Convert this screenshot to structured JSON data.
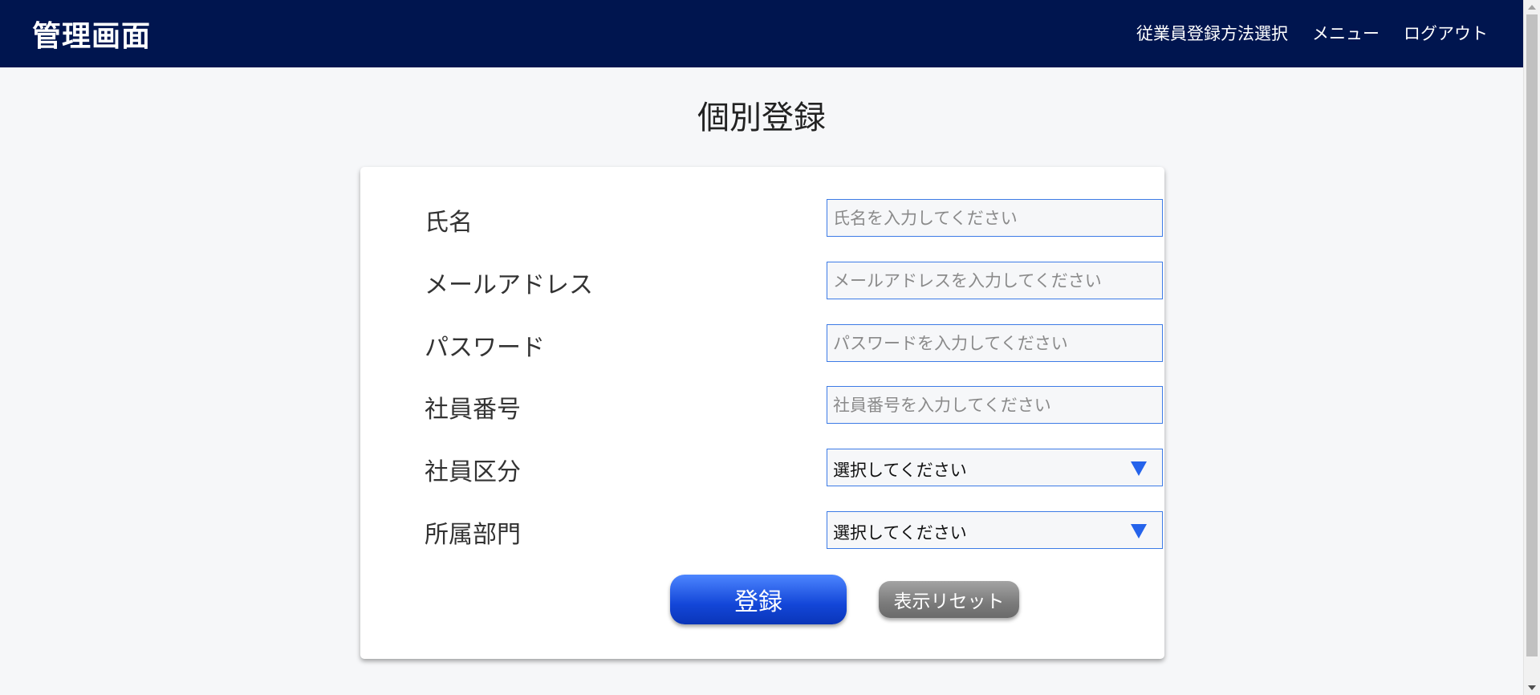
{
  "header": {
    "logo": "管理画面",
    "nav": [
      {
        "label": "従業員登録方法選択"
      },
      {
        "label": "メニュー"
      },
      {
        "label": "ログアウト"
      }
    ],
    "background": "#00154f"
  },
  "page": {
    "title": "個別登録"
  },
  "form": {
    "name": {
      "label": "氏名",
      "placeholder": "氏名を入力してください",
      "value": ""
    },
    "email": {
      "label": "メールアドレス",
      "placeholder": "メールアドレスを入力してください",
      "value": ""
    },
    "password": {
      "label": "パスワード",
      "placeholder": "パスワードを入力してください",
      "value": ""
    },
    "employee_number": {
      "label": "社員番号",
      "placeholder": "社員番号を入力してください",
      "value": ""
    },
    "employee_type": {
      "label": "社員区分",
      "selected": "選択してください",
      "icon": "caret-down-icon"
    },
    "department": {
      "label": "所属部門",
      "selected": "選択してください",
      "icon": "caret-down-icon"
    },
    "submit_label": "登録",
    "reset_label": "表示リセット"
  },
  "colors": {
    "accent": "#2563eb",
    "field_border": "#3d7be6",
    "reset_button": "#7b7b7b"
  }
}
